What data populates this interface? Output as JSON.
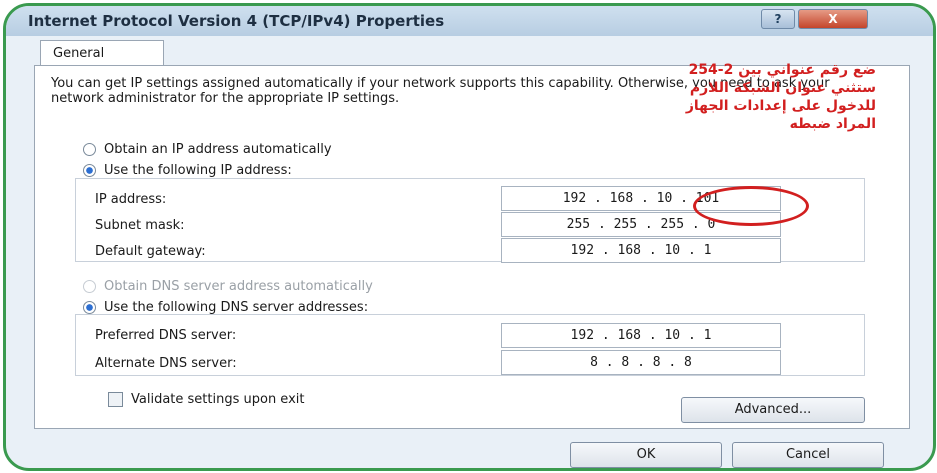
{
  "window": {
    "title": "Internet Protocol Version 4 (TCP/IPv4) Properties",
    "help_label": "?",
    "close_label": "X"
  },
  "tabs": [
    {
      "label": "General",
      "active": true
    }
  ],
  "intro_text": "You can get IP settings assigned automatically if your network supports this capability. Otherwise, you need to ask your network administrator for the appropriate IP settings.",
  "ip_section": {
    "auto_label": "Obtain an IP address automatically",
    "auto_selected": false,
    "manual_label": "Use the following IP address:",
    "manual_selected": true,
    "fields": [
      {
        "label": "IP address:",
        "value": "192 . 168 . 10 . 101"
      },
      {
        "label": "Subnet mask:",
        "value": "255 . 255 . 255 . 0"
      },
      {
        "label": "Default gateway:",
        "value": "192 . 168 . 10 . 1"
      }
    ]
  },
  "dns_section": {
    "auto_label": "Obtain DNS server address automatically",
    "auto_selected": false,
    "auto_disabled": true,
    "manual_label": "Use the following DNS server addresses:",
    "manual_selected": true,
    "fields": [
      {
        "label": "Preferred DNS server:",
        "value": "192 . 168 . 10 . 1"
      },
      {
        "label": "Alternate DNS server:",
        "value": "8 . 8 . 8 . 8"
      }
    ]
  },
  "annotation": {
    "lines": [
      "ضع رقم عنواني بين 2-254",
      "ستثني عنوان الشبكة اللازم",
      "للدخول على إعدادات الجهاز",
      "المراد ضبطه"
    ],
    "color": "#d21f1f"
  },
  "validate": {
    "label": "Validate settings upon exit",
    "checked": false
  },
  "buttons": {
    "advanced": "Advanced...",
    "ok": "OK",
    "cancel": "Cancel"
  },
  "colors": {
    "accent": "#2d6fd2",
    "frame": "#3a9a4f"
  }
}
